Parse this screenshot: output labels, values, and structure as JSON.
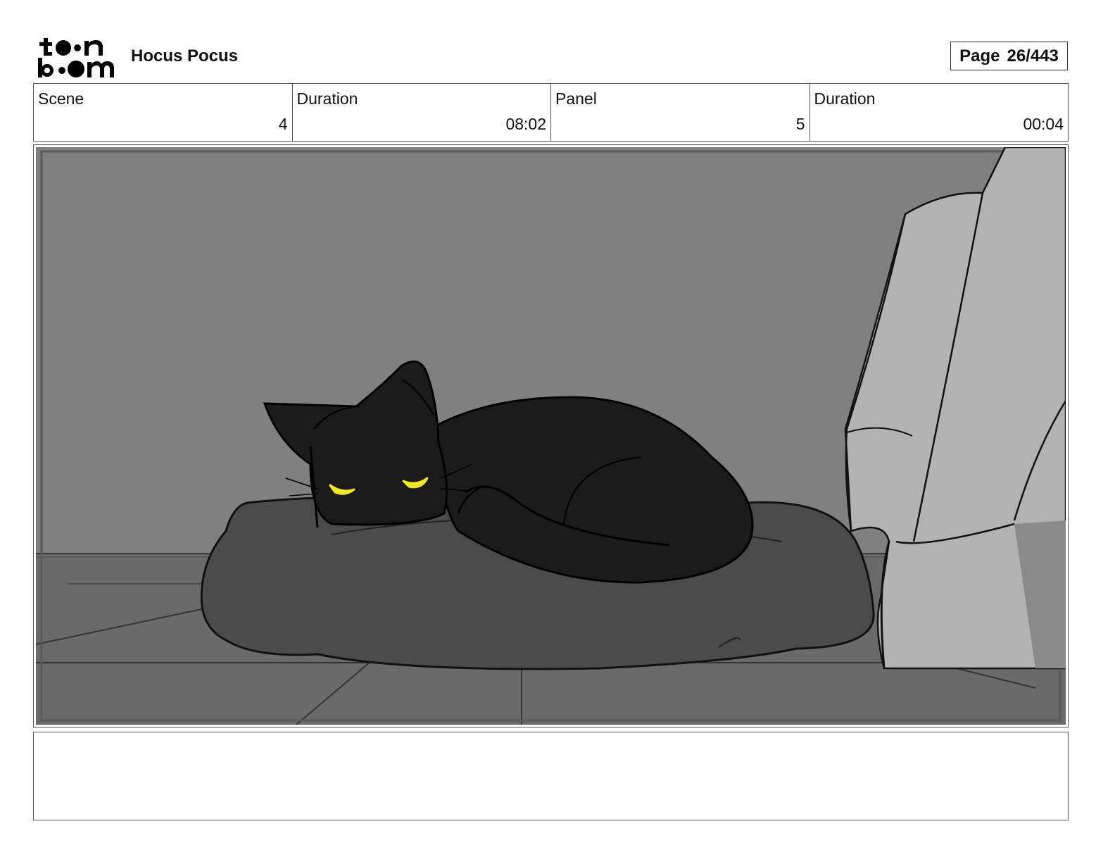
{
  "header": {
    "logo_text": "toonboom",
    "project_title": "Hocus Pocus",
    "page_label": "Page",
    "page_number": "26/443"
  },
  "info": {
    "scene_label": "Scene",
    "scene_value": "4",
    "scene_duration_label": "Duration",
    "scene_duration_value": "08:02",
    "panel_label": "Panel",
    "panel_value": "5",
    "panel_duration_label": "Duration",
    "panel_duration_value": "00:04"
  },
  "panel": {
    "eye_color": "#f2ea1a",
    "cat_color": "#1b1b1b",
    "wall_color": "#808080",
    "floor_color": "#6a6a6a",
    "cushion_color": "#4b4b4b",
    "furniture_color": "#b3b3b3"
  },
  "notes": {
    "text": ""
  }
}
